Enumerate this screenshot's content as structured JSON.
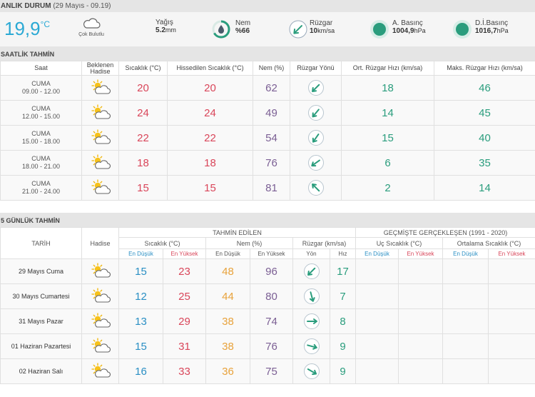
{
  "current": {
    "title": "ANLIK DURUM",
    "timestamp": "(29 Mayıs - 09.19)",
    "temp": "19,9",
    "temp_unit": "°C",
    "condition": "Çok Bulutlu",
    "rain_label": "Yağış",
    "rain_value": "5.2",
    "rain_unit": "mm",
    "humidity_label": "Nem",
    "humidity_value": "%66",
    "wind_label": "Rüzgar",
    "wind_value": "10",
    "wind_unit": "km/sa",
    "pressure_label": "A. Basınç",
    "pressure_value": "1004,9",
    "pressure_unit": "hPa",
    "sea_pressure_label": "D.İ.Basınç",
    "sea_pressure_value": "1016,7",
    "sea_pressure_unit": "hPa"
  },
  "hourly": {
    "title": "SAATLİK TAHMİN",
    "headers": {
      "time": "Saat",
      "event_1": "Beklenen",
      "event_2": "Hadise",
      "temp": "Sıcaklık (°C)",
      "feels": "Hissedilen Sıcaklık (°C)",
      "humidity": "Nem (%)",
      "wind_dir": "Rüzgar Yönü",
      "wind_avg": "Ort. Rüzgar Hızı (km/sa)",
      "wind_max": "Maks. Rüzgar Hızı (km/sa)"
    },
    "rows": [
      {
        "day": "CUMA",
        "time": "09.00 - 12.00",
        "icon": "partly-cloudy-icon",
        "temp": "20",
        "feels": "20",
        "humidity": "62",
        "wind_dir_deg": 225,
        "wind_avg": "18",
        "wind_max": "46"
      },
      {
        "day": "CUMA",
        "time": "12.00 - 15.00",
        "icon": "partly-cloudy-icon",
        "temp": "24",
        "feels": "24",
        "humidity": "49",
        "wind_dir_deg": 220,
        "wind_avg": "14",
        "wind_max": "45"
      },
      {
        "day": "CUMA",
        "time": "15.00 - 18.00",
        "icon": "partly-cloudy-icon",
        "temp": "22",
        "feels": "22",
        "humidity": "54",
        "wind_dir_deg": 215,
        "wind_avg": "15",
        "wind_max": "40"
      },
      {
        "day": "CUMA",
        "time": "18.00 - 21.00",
        "icon": "partly-cloudy-icon",
        "temp": "18",
        "feels": "18",
        "humidity": "76",
        "wind_dir_deg": 235,
        "wind_avg": "6",
        "wind_max": "35"
      },
      {
        "day": "CUMA",
        "time": "21.00 - 24.00",
        "icon": "partly-cloudy-icon",
        "temp": "15",
        "feels": "15",
        "humidity": "81",
        "wind_dir_deg": 315,
        "wind_avg": "2",
        "wind_max": "14"
      }
    ]
  },
  "daily": {
    "title": "5 GÜNLÜK TAHMİN",
    "headers": {
      "date": "TARİH",
      "event": "Hadise",
      "forecast": "TAHMİN EDİLEN",
      "temp": "Sıcaklık (°C)",
      "humidity": "Nem (%)",
      "wind": "Rüzgar (km/sa)",
      "history": "GEÇMİŞTE GERÇEKLEŞEN (1991 - 2020)",
      "extreme_temp": "Uç Sıcaklık (°C)",
      "avg_temp": "Ortalama Sıcaklık (°C)",
      "low": "En Düşük",
      "high": "En Yüksek",
      "dir": "Yön",
      "speed": "Hız"
    },
    "rows": [
      {
        "date": "29 Mayıs Cuma",
        "icon": "partly-cloudy-icon",
        "t_low": "15",
        "t_high": "23",
        "h_low": "48",
        "h_high": "96",
        "wind_dir_deg": 225,
        "wind_speed": "17"
      },
      {
        "date": "30 Mayıs Cumartesi",
        "icon": "partly-cloudy-icon",
        "t_low": "12",
        "t_high": "25",
        "h_low": "44",
        "h_high": "80",
        "wind_dir_deg": 165,
        "wind_speed": "7"
      },
      {
        "date": "31 Mayıs Pazar",
        "icon": "partly-cloudy-icon",
        "t_low": "13",
        "t_high": "29",
        "h_low": "38",
        "h_high": "74",
        "wind_dir_deg": 90,
        "wind_speed": "8"
      },
      {
        "date": "01 Haziran Pazartesi",
        "icon": "partly-cloudy-icon",
        "t_low": "15",
        "t_high": "31",
        "h_low": "38",
        "h_high": "76",
        "wind_dir_deg": 105,
        "wind_speed": "9"
      },
      {
        "date": "02 Haziran Salı",
        "icon": "partly-cloudy-icon",
        "t_low": "16",
        "t_high": "33",
        "h_low": "36",
        "h_high": "75",
        "wind_dir_deg": 120,
        "wind_speed": "9"
      }
    ]
  },
  "colors": {
    "accent_blue": "#2ba9d4",
    "teal": "#2a9d7d",
    "red": "#d9465a",
    "orange": "#e8a23b",
    "purple": "#7b5f94"
  }
}
